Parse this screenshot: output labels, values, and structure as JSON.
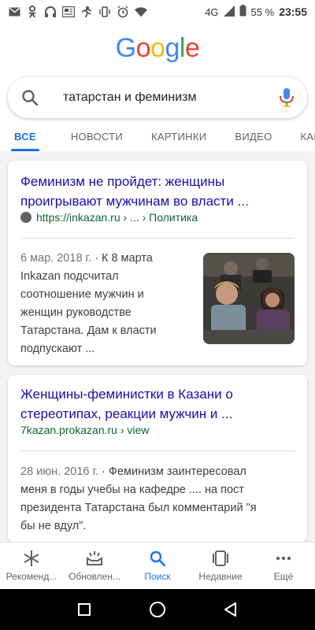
{
  "status_bar": {
    "battery": "55 %",
    "network": "4G",
    "time": "23:55",
    "icons": [
      "mail-icon",
      "odnoklassniki-icon",
      "headset-icon",
      "news-icon",
      "activity-icon",
      "vibrate-icon",
      "alarm-icon",
      "wifi-icon",
      "signal-icon",
      "battery-icon"
    ]
  },
  "logo": {
    "letters": [
      "G",
      "o",
      "o",
      "g",
      "l",
      "e"
    ],
    "colors": [
      "#4285f4",
      "#ea4335",
      "#fbbc05",
      "#4285f4",
      "#34a853",
      "#ea4335"
    ]
  },
  "search": {
    "query": "татарстан и феминизм"
  },
  "tabs": [
    {
      "label": "ВСЕ",
      "active": true
    },
    {
      "label": "НОВОСТИ"
    },
    {
      "label": "КАРТИНКИ"
    },
    {
      "label": "ВИДЕО"
    },
    {
      "label": "КАРТ"
    }
  ],
  "results": [
    {
      "title_line1": "Феминизм не пройдет: женщины",
      "title_line2": "проигрывают мужчинам во власти ...",
      "url": "https://inkazan.ru › ... › Политика",
      "date": "6 мар. 2018 г.",
      "snippet_lines": [
        "К 8 марта",
        "Inkazan подсчитал",
        "соотношение мужчин и",
        "женщин руководстве",
        "Татарстана. Дам к власти",
        "подпускают ..."
      ]
    },
    {
      "title_line1": "Женщины-феминистки в Казани о",
      "title_line2": "стереотипах, реакции мужчин и ...",
      "url": "7kazan.prokazan.ru › view",
      "date": "28 июн. 2016 г.",
      "snippet_lines": [
        "Феминизм заинтересовал",
        "меня в годы учебы на кафедре .... на пост",
        "президента Татарстана был комментарий \"я",
        "бы не вдул\"."
      ]
    }
  ],
  "bottom_nav": [
    {
      "label": "Рекоменд...",
      "icon": "asterisk-icon"
    },
    {
      "label": "Обновлен...",
      "icon": "updates-icon"
    },
    {
      "label": "Поиск",
      "icon": "search-icon",
      "active": true
    },
    {
      "label": "Недавние",
      "icon": "recent-icon"
    },
    {
      "label": "Ещё",
      "icon": "more-icon"
    }
  ],
  "colors": {
    "link": "#1a0dab",
    "url_green": "#0d652d",
    "accent": "#1a73e8"
  }
}
